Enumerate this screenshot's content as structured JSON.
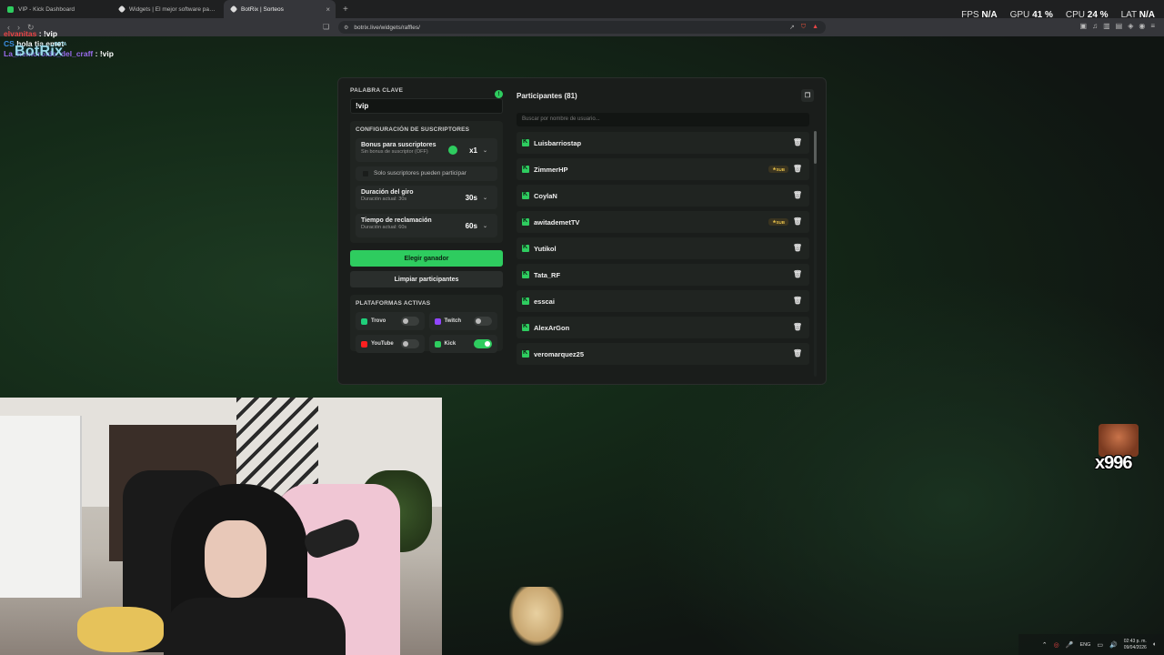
{
  "browser": {
    "tabs": [
      {
        "title": "VIP - Kick Dashboard",
        "color": "#2ecc5f"
      },
      {
        "title": "Widgets | El mejor software para pro",
        "color": "#ffffff"
      },
      {
        "title": "BotRix | Sorteos",
        "color": "#ffffff",
        "active": true
      }
    ],
    "url": "botrix.live/widgets/raffles/"
  },
  "stats": {
    "fps_label": "FPS",
    "fps_value": "N/A",
    "gpu_label": "GPU",
    "gpu_value": "41 %",
    "cpu_label": "CPU",
    "cpu_value": "24 %",
    "lat_label": "LAT",
    "lat_value": "N/A"
  },
  "chat": [
    {
      "user": "elvanitas",
      "msg": "!vip",
      "color": "#e84545"
    },
    {
      "user": "CS",
      "msg": "hola tia emet",
      "color": "#3a8de0"
    },
    {
      "user": "La_hemoroide_del_craff",
      "msg": "!vip",
      "color": "#9b6cf0"
    }
  ],
  "logo": {
    "text": "BotRix",
    "badge": "BETA"
  },
  "raffle": {
    "keyword_label": "PALABRA CLAVE",
    "keyword_value": "!vip",
    "sub_config_title": "CONFIGURACIÓN DE SUSCRIPTORES",
    "bonus_title": "Bonus para suscriptores",
    "bonus_sub": "Sin bonus de suscriptor (OFF)",
    "bonus_value": "x1",
    "only_subs": "Solo suscriptores pueden participar",
    "spin_title": "Duración del giro",
    "spin_sub": "Duración actual: 30s",
    "spin_value": "30s",
    "claim_title": "Tiempo de reclamación",
    "claim_sub": "Duración actual: 60s",
    "claim_value": "60s",
    "pick_winner": "Elegir ganador",
    "clear_participants": "Limpiar participantes",
    "platforms_title": "PLATAFORMAS ACTIVAS",
    "platforms": [
      {
        "name": "Trovo",
        "color": "#1fcf7a",
        "on": false
      },
      {
        "name": "Twitch",
        "color": "#9146ff",
        "on": false
      },
      {
        "name": "YouTube",
        "color": "#ff2020",
        "on": false
      },
      {
        "name": "Kick",
        "color": "#2ecc5f",
        "on": true
      }
    ]
  },
  "participants": {
    "title": "Participantes (81)",
    "search_placeholder": "Buscar por nombre de usuario...",
    "sub_label": "SUB",
    "items": [
      {
        "name": "Luisbarriostap",
        "sub": false
      },
      {
        "name": "ZimmerHP",
        "sub": true
      },
      {
        "name": "CoylaN",
        "sub": false
      },
      {
        "name": "awitademetTV",
        "sub": true
      },
      {
        "name": "Yutikol",
        "sub": false
      },
      {
        "name": "Tata_RF",
        "sub": false
      },
      {
        "name": "esscai",
        "sub": false
      },
      {
        "name": "AlexArGon",
        "sub": false
      },
      {
        "name": "veromarquez25",
        "sub": false
      }
    ]
  },
  "overlay": {
    "emote_count": "x996"
  },
  "taskbar": {
    "lang": "ENG",
    "time": "02:43 p. m.",
    "date": "09/04/2026"
  }
}
